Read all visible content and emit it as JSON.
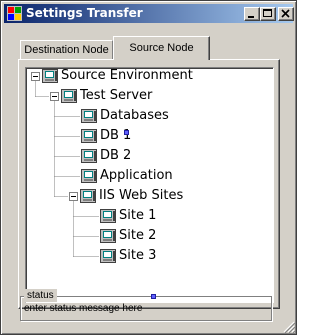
{
  "window": {
    "title": "Settings Transfer",
    "icon": "app-icon",
    "controls": [
      "minimize-icon",
      "maximize-icon",
      "close-icon"
    ]
  },
  "tabs": [
    {
      "label": "Destination Node",
      "selected": false
    },
    {
      "label": "Source Node",
      "selected": true
    }
  ],
  "tree": {
    "nodes": [
      {
        "label": "Source Environment",
        "depth": 0,
        "expander": "minus",
        "icon": "computer-node-icon"
      },
      {
        "label": "Test Server",
        "depth": 1,
        "expander": "minus",
        "icon": "computer-node-icon"
      },
      {
        "label": "Databases",
        "depth": 2,
        "expander": "none",
        "icon": "computer-node-icon"
      },
      {
        "label": "DB 1",
        "depth": 2,
        "expander": "none",
        "icon": "computer-node-icon"
      },
      {
        "label": "DB 2",
        "depth": 2,
        "expander": "none",
        "icon": "computer-node-icon"
      },
      {
        "label": "Application",
        "depth": 2,
        "expander": "none",
        "icon": "computer-node-icon"
      },
      {
        "label": "IIS Web Sites",
        "depth": 2,
        "expander": "minus",
        "icon": "computer-node-icon"
      },
      {
        "label": "Site 1",
        "depth": 3,
        "expander": "none",
        "icon": "computer-node-icon"
      },
      {
        "label": "Site 2",
        "depth": 3,
        "expander": "none",
        "icon": "computer-node-icon"
      },
      {
        "label": "Site 3",
        "depth": 3,
        "expander": "none",
        "icon": "computer-node-icon"
      }
    ]
  },
  "status": {
    "group_label": "status",
    "message": "enter status message here"
  },
  "colors": {
    "title_start": "#0a246a",
    "title_end": "#a6caf0",
    "face": "#d4d0c8",
    "marker": "#6060ff"
  }
}
